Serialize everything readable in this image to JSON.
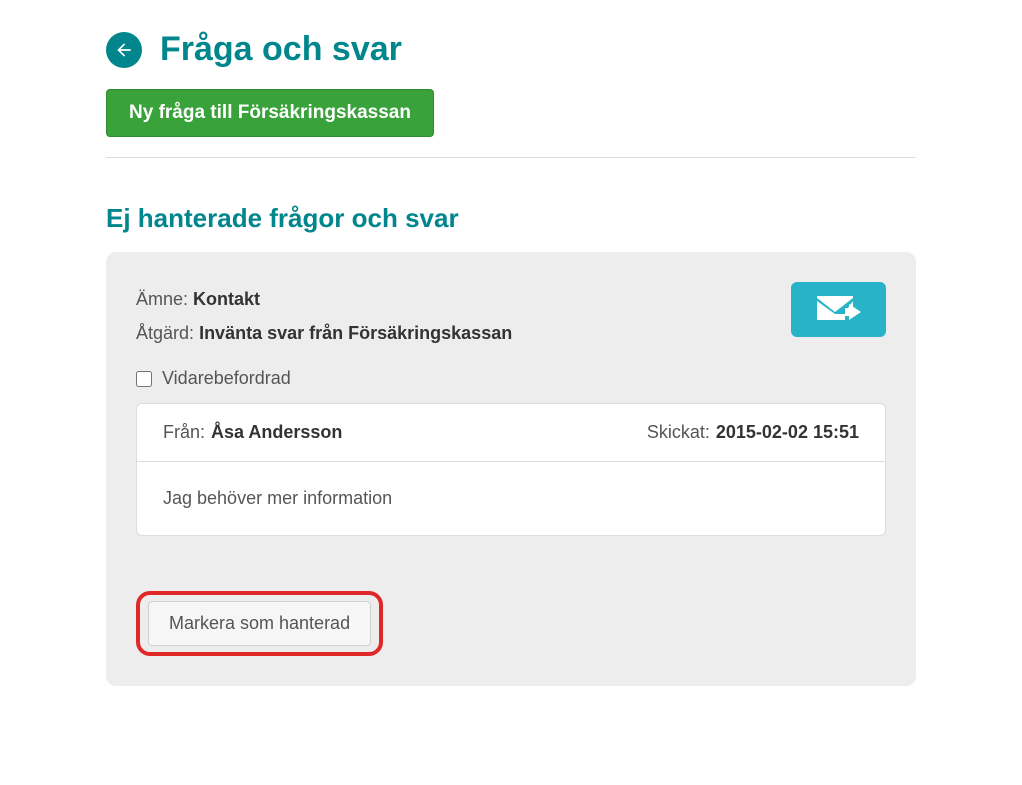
{
  "header": {
    "title": "Fråga och svar",
    "new_question_label": "Ny fråga till Försäkringskassan"
  },
  "section": {
    "title": "Ej hanterade frågor och svar"
  },
  "card": {
    "subject_label": "Ämne:",
    "subject_value": "Kontakt",
    "action_label": "Åtgärd:",
    "action_value": "Invänta svar från Försäkringskassan",
    "forwarded_label": "Vidarebefordrad",
    "forwarded_checked": false,
    "message": {
      "from_label": "Från:",
      "from_value": "Åsa Andersson",
      "sent_label": "Skickat:",
      "sent_value": "2015-02-02 15:51",
      "body": "Jag behöver mer information"
    },
    "mark_handled_label": "Markera som hanterad"
  }
}
